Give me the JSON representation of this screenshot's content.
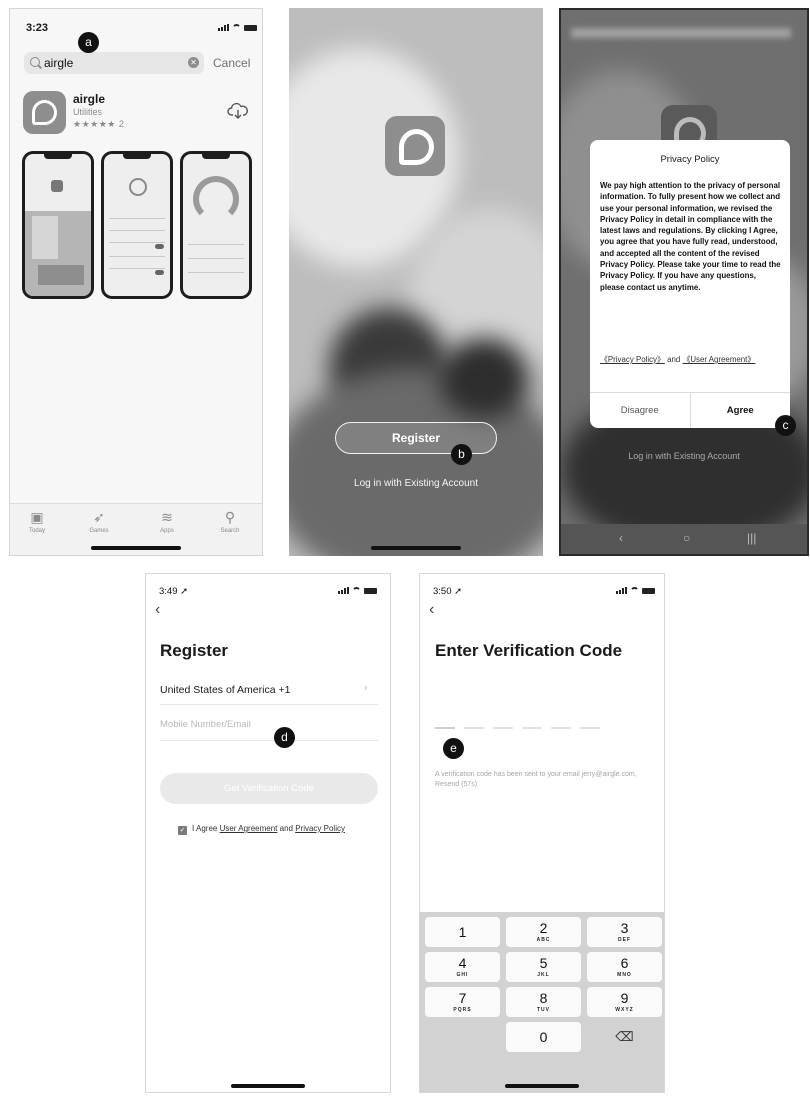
{
  "markers": {
    "a": "a",
    "b": "b",
    "c": "c",
    "d": "d",
    "e": "e"
  },
  "screen1": {
    "time": "3:23",
    "search_value": "airgle",
    "cancel_label": "Cancel",
    "app": {
      "name": "airgle",
      "category": "Utilities",
      "stars": "★★★★★ 2"
    },
    "tabs": [
      {
        "label": "Today",
        "icon": "today-icon"
      },
      {
        "label": "Games",
        "icon": "rocket-icon"
      },
      {
        "label": "Apps",
        "icon": "layers-icon"
      },
      {
        "label": "Search",
        "icon": "search-icon"
      }
    ]
  },
  "screen2": {
    "register_label": "Register",
    "login_label": "Log in with Existing Account"
  },
  "screen3": {
    "dialog_title": "Privacy Policy",
    "dialog_body": "We pay high attention to the privacy of personal information. To fully present how we collect and use your personal information, we revised the Privacy Policy in detail in compliance with the latest laws and regulations. By clicking I Agree, you agree that you have fully read, understood, and accepted all the content of the revised Privacy Policy. Please take your time to read the Privacy Policy. If you have any questions, please contact us anytime.",
    "privacy_link": "《Privacy Policy》",
    "and_text": " and ",
    "agreement_link": "《User Agreement》",
    "disagree_label": "Disagree",
    "agree_label": "Agree",
    "login_label": "Log in with Existing Account"
  },
  "screen4": {
    "time": "3:49 ➚",
    "title": "Register",
    "country": "United States of America +1",
    "input_placeholder": "Mobile Number/Email",
    "button_label": "Get Verification Code",
    "agree_prefix": "I Agree ",
    "user_agreement": "User Agreement",
    "and_text": " and ",
    "privacy_policy": "Privacy Policy"
  },
  "screen5": {
    "time": "3:50 ➚",
    "title": "Enter Verification Code",
    "info_text": "A verification code has been sent to your email jerry@airgle.com, Resend (57s)",
    "keys": [
      {
        "num": "1",
        "letters": ""
      },
      {
        "num": "2",
        "letters": "ABC"
      },
      {
        "num": "3",
        "letters": "DEF"
      },
      {
        "num": "4",
        "letters": "GHI"
      },
      {
        "num": "5",
        "letters": "JKL"
      },
      {
        "num": "6",
        "letters": "MNO"
      },
      {
        "num": "7",
        "letters": "PQRS"
      },
      {
        "num": "8",
        "letters": "TUV"
      },
      {
        "num": "9",
        "letters": "WXYZ"
      },
      {
        "num": "0",
        "letters": ""
      }
    ]
  }
}
